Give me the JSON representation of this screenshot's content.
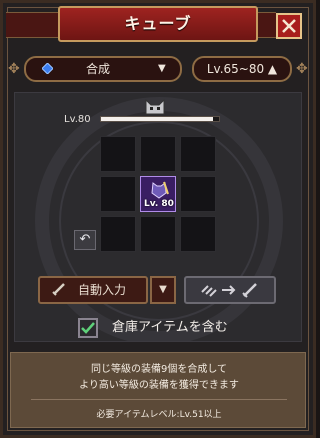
{
  "header": {
    "title": "キューブ"
  },
  "close": {
    "icon": "close-icon"
  },
  "selectors": {
    "mode": {
      "value": "合成",
      "icon": "blue-gem-icon"
    },
    "level": {
      "value": "Lv.65~80 ▲"
    }
  },
  "cube": {
    "level_label": "Lv.80",
    "level_progress": 0.95,
    "item": {
      "level": "Lv. 80",
      "rarity_color": "#b08ce8"
    }
  },
  "buttons": {
    "auto_input": "自動入力",
    "combine": {
      "icon": "swap-to-sword-icon"
    }
  },
  "option": {
    "include_storage": "倉庫アイテムを含む",
    "checked": true
  },
  "info": {
    "line1": "同じ等級の装備9個を合成して",
    "line2": "より高い等級の装備を獲得できます",
    "requirement": "必要アイテムレベル:Lv.51以上"
  },
  "colors": {
    "accent": "#9e2320",
    "gold": "#c59a5e",
    "check": "#5fd17a"
  }
}
